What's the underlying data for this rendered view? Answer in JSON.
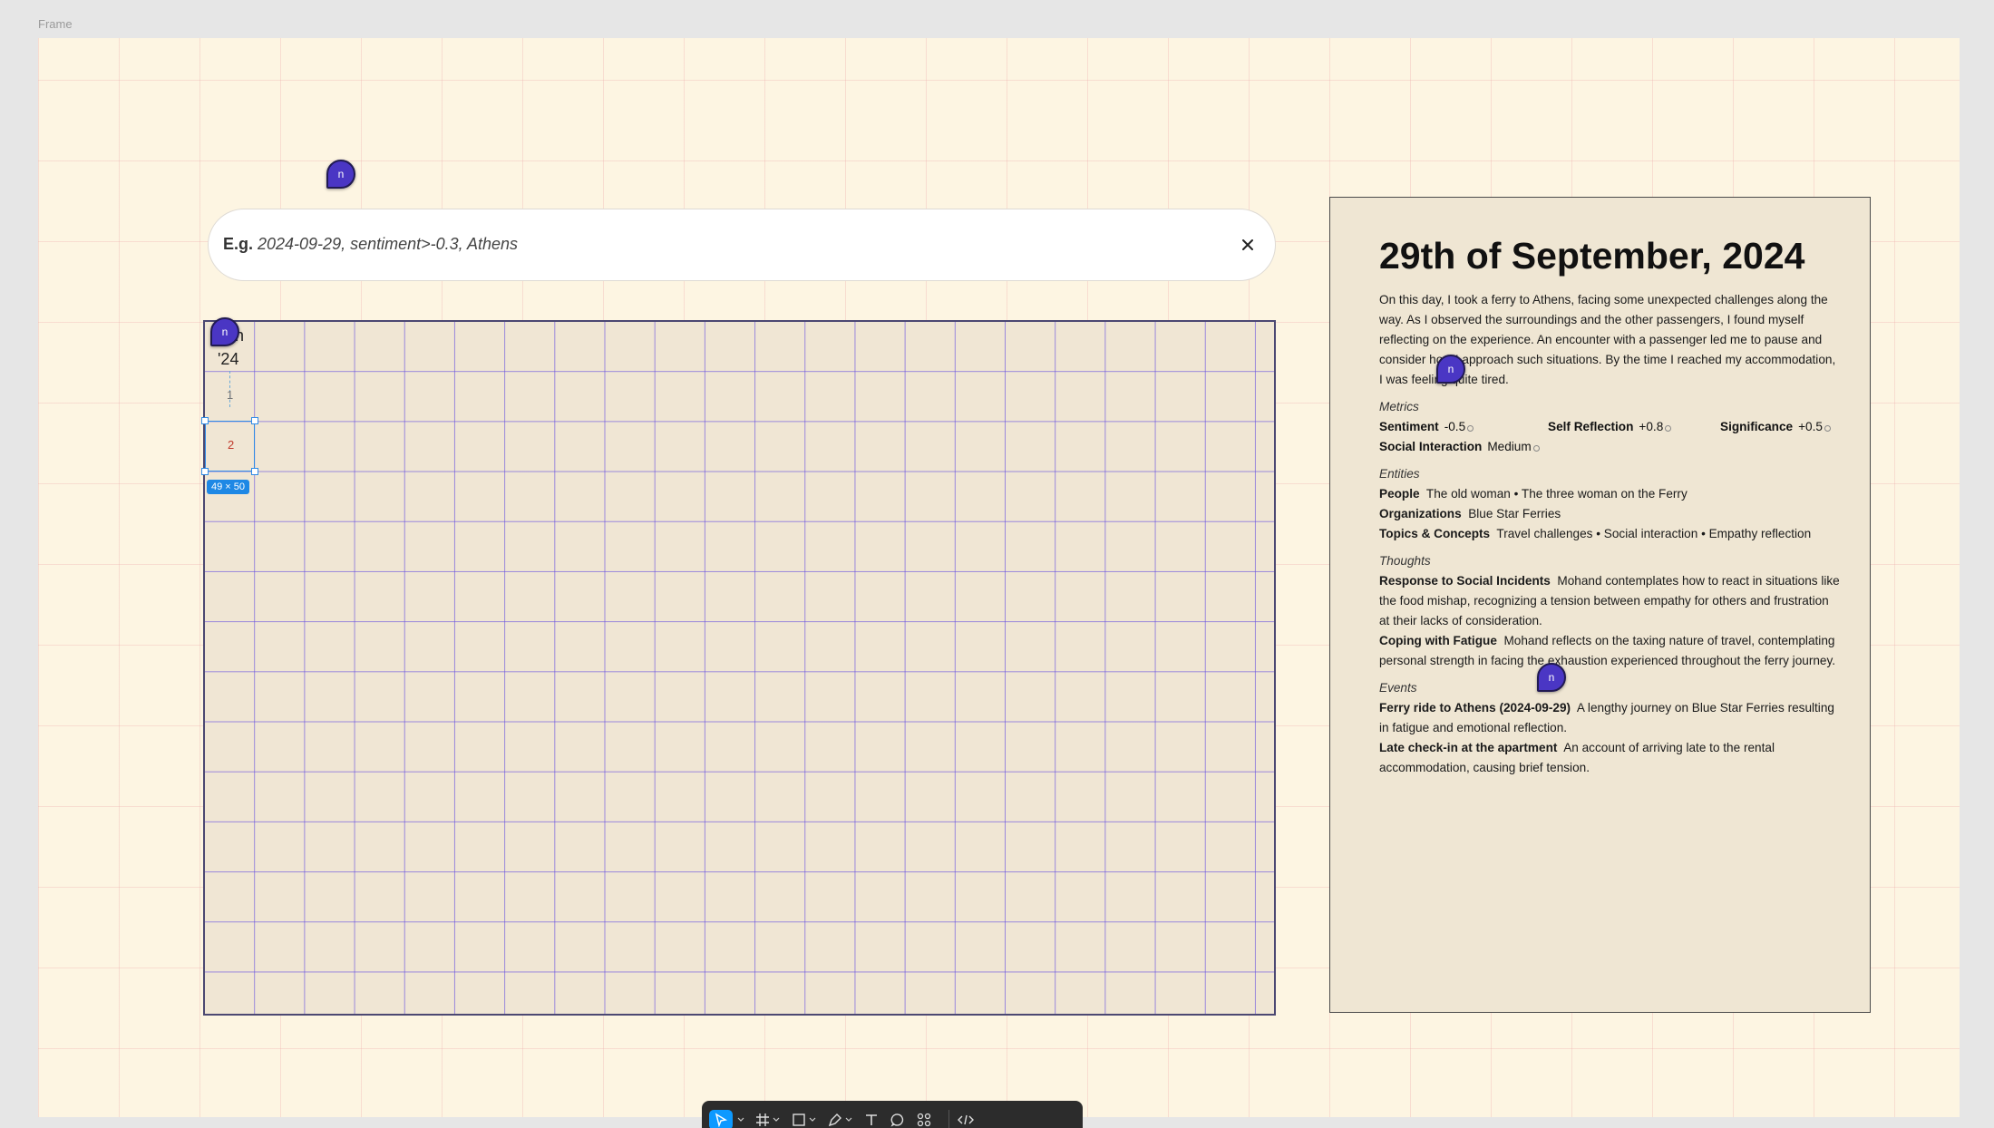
{
  "canvas": {
    "frame_label": "Frame"
  },
  "search": {
    "prefix": "E.g.",
    "placeholder": "2024-09-29, sentiment>-0.3, Athens",
    "value": ""
  },
  "calendar": {
    "month_label_line1": "Jan",
    "month_label_line2": "'24",
    "day_1": "1",
    "day_2": "2",
    "selection_size": "49 × 50"
  },
  "journal": {
    "title": "29th of September, 2024",
    "summary": "On this day, I took a ferry to Athens, facing some unexpected challenges along the way. As I observed the surroundings and the other passengers, I found myself reflecting on the experience. An encounter with a passenger led me to pause and consider how I approach such situations. By the time I reached my accommodation, I was feeling quite tired.",
    "metrics_heading": "Metrics",
    "metrics": [
      {
        "label": "Sentiment",
        "value": "-0.5"
      },
      {
        "label": "Self Reflection",
        "value": "+0.8"
      },
      {
        "label": "Significance",
        "value": "+0.5"
      },
      {
        "label": "Social Interaction",
        "value": "Medium"
      }
    ],
    "entities_heading": "Entities",
    "entities": [
      {
        "label": "People",
        "value": "The old woman • The three woman on the Ferry"
      },
      {
        "label": "Organizations",
        "value": "Blue Star Ferries"
      },
      {
        "label": "Topics & Concepts",
        "value": "Travel challenges • Social interaction • Empathy reflection"
      }
    ],
    "thoughts_heading": "Thoughts",
    "thoughts": [
      {
        "label": "Response to Social Incidents",
        "value": "Mohand contemplates how to react in situations like the food mishap, recognizing a tension between empathy for others and frustration at their lacks of consideration."
      },
      {
        "label": "Coping with Fatigue",
        "value": "Mohand reflects on the taxing nature of travel, contemplating personal strength in facing the exhaustion experienced throughout the ferry journey."
      }
    ],
    "events_heading": "Events",
    "events": [
      {
        "label": "Ferry ride to Athens (2024-09-29)",
        "value": "A lengthy journey on Blue Star Ferries resulting in fatigue and emotional reflection."
      },
      {
        "label": "Late check-in at the apartment",
        "value": "An account of arriving late to the rental accommodation, causing brief tension."
      }
    ]
  },
  "collaborators": [
    {
      "initial": "n"
    },
    {
      "initial": "n"
    },
    {
      "initial": "n"
    },
    {
      "initial": "n"
    }
  ],
  "toolbar": {
    "tools": [
      "move-tool",
      "frame-tool",
      "shape-tool",
      "pen-tool",
      "text-tool",
      "comment-tool",
      "actions-tool",
      "dev-mode-tool"
    ],
    "active_tool": "move-tool"
  }
}
